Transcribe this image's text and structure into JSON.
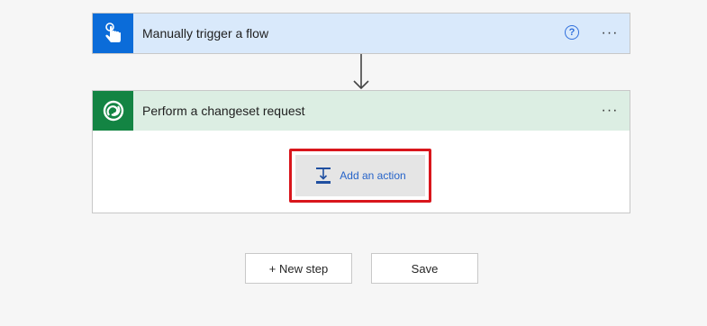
{
  "trigger": {
    "title": "Manually trigger a flow",
    "icon": "touch-hand-icon",
    "help_glyph": "?",
    "more_glyph": "···",
    "accent": "#0b6cd9",
    "header_bg": "#d9e9fb"
  },
  "action": {
    "title": "Perform a changeset request",
    "icon": "dataverse-icon",
    "more_glyph": "···",
    "accent": "#138443",
    "header_bg": "#dceee3",
    "add_action_label": "Add an action"
  },
  "footer": {
    "new_step_label": "+ New step",
    "save_label": "Save"
  },
  "highlight_color": "#d9161c"
}
